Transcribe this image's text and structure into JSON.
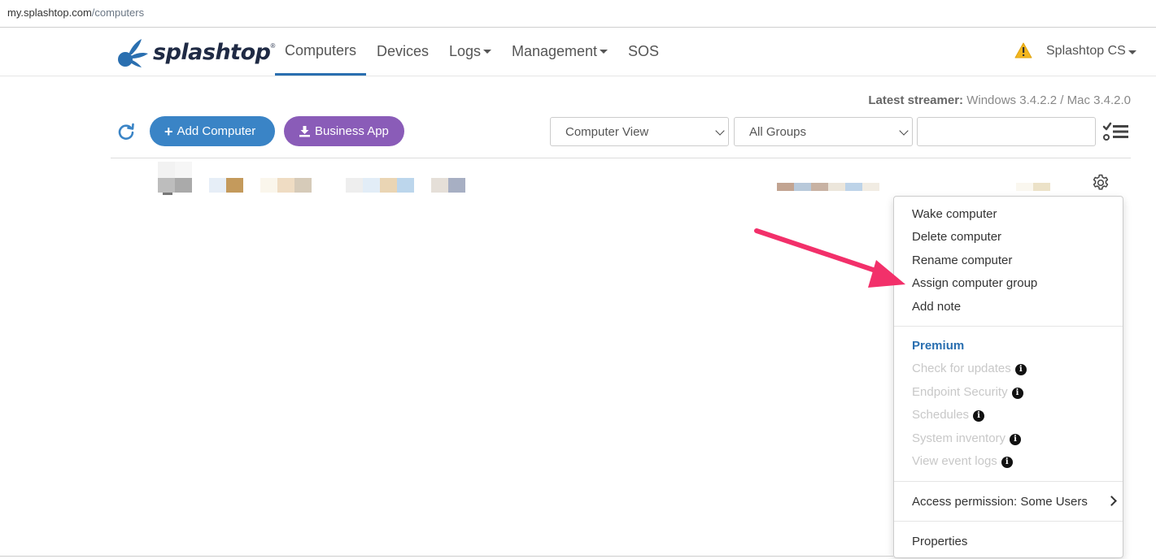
{
  "browser": {
    "url_host": "my.splashtop.com",
    "url_path": "/computers"
  },
  "brand": {
    "name": "splashtop",
    "trademark": "®",
    "primary_color": "#2a6fb0"
  },
  "nav": {
    "items": [
      {
        "label": "Computers",
        "active": true
      },
      {
        "label": "Devices",
        "active": false
      },
      {
        "label": "Logs",
        "active": false
      },
      {
        "label": "Management",
        "active": false
      },
      {
        "label": "SOS",
        "active": false
      }
    ],
    "account": "Splashtop CS",
    "warning_icon": "warning-triangle-icon"
  },
  "streamer": {
    "label": "Latest streamer:",
    "windows": "Windows 3.4.2.2",
    "separator": "/",
    "mac": "Mac 3.4.2.0"
  },
  "toolbar": {
    "add_computer": "Add Computer",
    "business_app": "Business App",
    "add_color": "#3a84c6",
    "business_color": "#8a5cb8",
    "view_select": "Computer View",
    "group_select": "All Groups",
    "search_value": ""
  },
  "context_menu": {
    "actions": [
      "Wake computer",
      "Delete computer",
      "Rename computer",
      "Assign computer group",
      "Add note"
    ],
    "premium_heading": "Premium",
    "premium_items": [
      "Check for updates",
      "Endpoint Security",
      "Schedules",
      "System inventory",
      "View event logs"
    ],
    "access_permission": "Access permission: Some Users",
    "properties": "Properties"
  },
  "annotation": {
    "arrow_color": "#f2306a",
    "points_to": "Assign computer group"
  }
}
